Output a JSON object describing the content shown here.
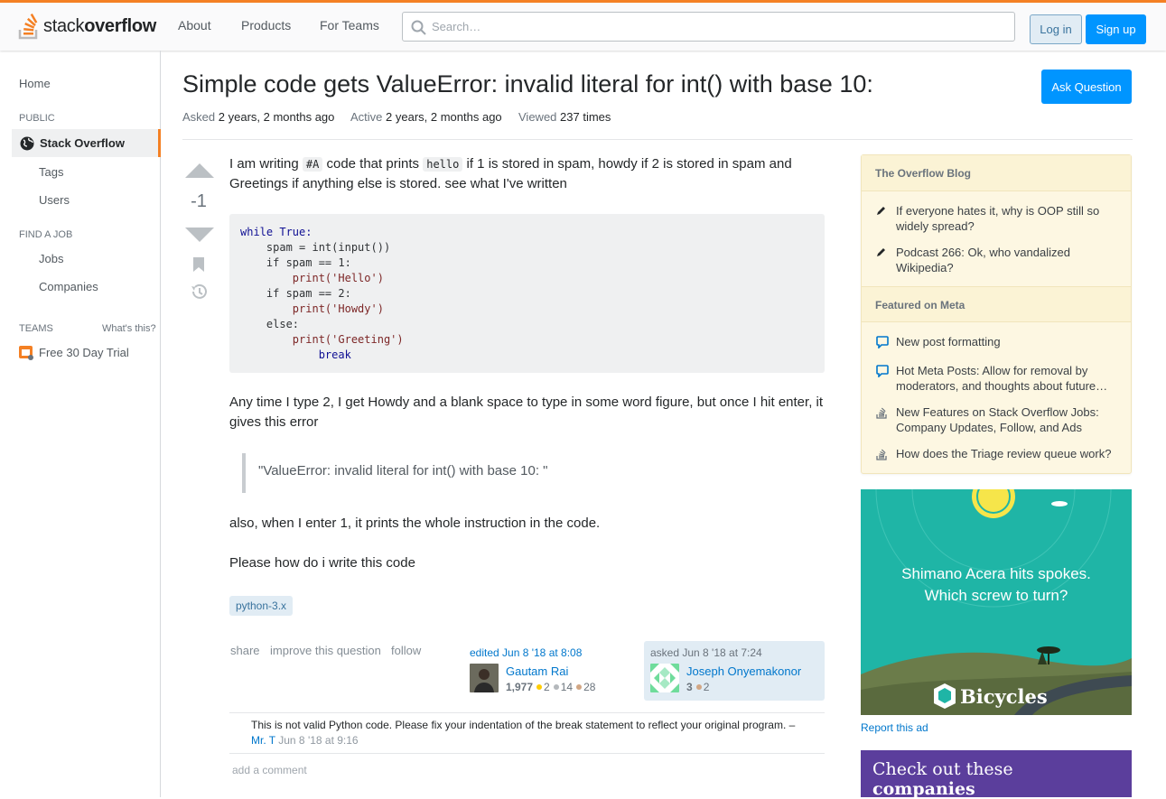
{
  "header": {
    "logo_text_light": "stack",
    "logo_text_bold": "overflow",
    "nav": [
      "About",
      "Products",
      "For Teams"
    ],
    "search_placeholder": "Search…",
    "login_label": "Log in",
    "signup_label": "Sign up",
    "accent_color": "#f48024"
  },
  "sidebar": {
    "home": "Home",
    "public_label": "PUBLIC",
    "stackoverflow": "Stack Overflow",
    "tags": "Tags",
    "users": "Users",
    "find_job_label": "FIND A JOB",
    "jobs": "Jobs",
    "companies": "Companies",
    "teams_label": "TEAMS",
    "whats_this": "What's this?",
    "free_trial": "Free 30 Day Trial"
  },
  "question": {
    "title": "Simple code gets ValueError: invalid literal for int() with base 10:",
    "ask_button": "Ask Question",
    "asked_label": "Asked",
    "asked_value": "2 years, 2 months ago",
    "active_label": "Active",
    "active_value": "2 years, 2 months ago",
    "viewed_label": "Viewed",
    "viewed_value": "237 times",
    "vote_count": "-1",
    "body_p1_a": "I am writing ",
    "body_p1_code1": "#A",
    "body_p1_b": " code that prints ",
    "body_p1_code2": "hello",
    "body_p1_c": " if 1 is stored in spam, howdy if 2 is stored in spam and Greetings if anything else is stored. see what I've written",
    "code_lines": [
      "while True:",
      "    spam = int(input())",
      "    if spam == 1:",
      "        print('Hello')",
      "    if spam == 2:",
      "        print('Howdy')",
      "    else:",
      "        print('Greeting')",
      "            break"
    ],
    "body_p2": "Any time I type 2, I get Howdy and a blank space to type in some word figure, but once I hit enter, it gives this error",
    "quote": "\"ValueError: invalid literal for int() with base 10: \"",
    "body_p3": "also, when I enter 1, it prints the whole instruction in the code.",
    "body_p4": "Please how do i write this code",
    "tag": "python-3.x",
    "menu": [
      "share",
      "improve this question",
      "follow"
    ],
    "editor": {
      "time": "edited Jun 8 '18 at 8:08",
      "name": "Gautam Rai",
      "rep": "1,977",
      "gold": "2",
      "silver": "14",
      "bronze": "28"
    },
    "asker": {
      "time": "asked Jun 8 '18 at 7:24",
      "name": "Joseph Onyemakonor",
      "rep": "3",
      "bronze": "2"
    },
    "comment_text": "This is not valid Python code. Please fix your indentation of the break statement to reflect your original program. –",
    "comment_user": "Mr. T",
    "comment_date": "Jun 8 '18 at 9:16",
    "add_comment": "add a comment"
  },
  "right": {
    "blog_title": "The Overflow Blog",
    "blog_items": [
      "If everyone hates it, why is OOP still so widely spread?",
      "Podcast 266: Ok, who vandalized Wikipedia?"
    ],
    "meta_title": "Featured on Meta",
    "meta_items": [
      "New post formatting",
      "Hot Meta Posts: Allow for removal by moderators, and thoughts about future…",
      "New Features on Stack Overflow Jobs: Company Updates, Follow, and Ads",
      "How does the Triage review queue work?"
    ],
    "ad_line1": "Shimano Acera hits spokes.",
    "ad_line2": "Which screw to turn?",
    "ad_logo": "Bicycles",
    "report_ad": "Report this ad",
    "companies_light": "Check out these ",
    "companies_bold": "companies"
  }
}
